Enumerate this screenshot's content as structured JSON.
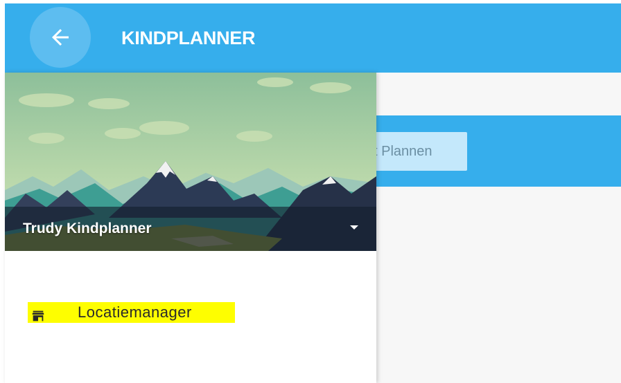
{
  "appbar": {
    "title": "KINDPLANNER",
    "back_icon": "arrow-left-icon",
    "color": "#36aeec"
  },
  "content": {
    "plan_button_label": "Plannen",
    "plan_button_prefix": "t"
  },
  "drawer": {
    "user_name": "Trudy Kindplanner",
    "dropdown_icon": "caret-down-icon",
    "items": [
      {
        "label": "Locatiemanager",
        "icon": "store-icon",
        "highlighted": true
      }
    ]
  },
  "colors": {
    "accent": "#36aeec",
    "highlight": "#fefe00"
  }
}
